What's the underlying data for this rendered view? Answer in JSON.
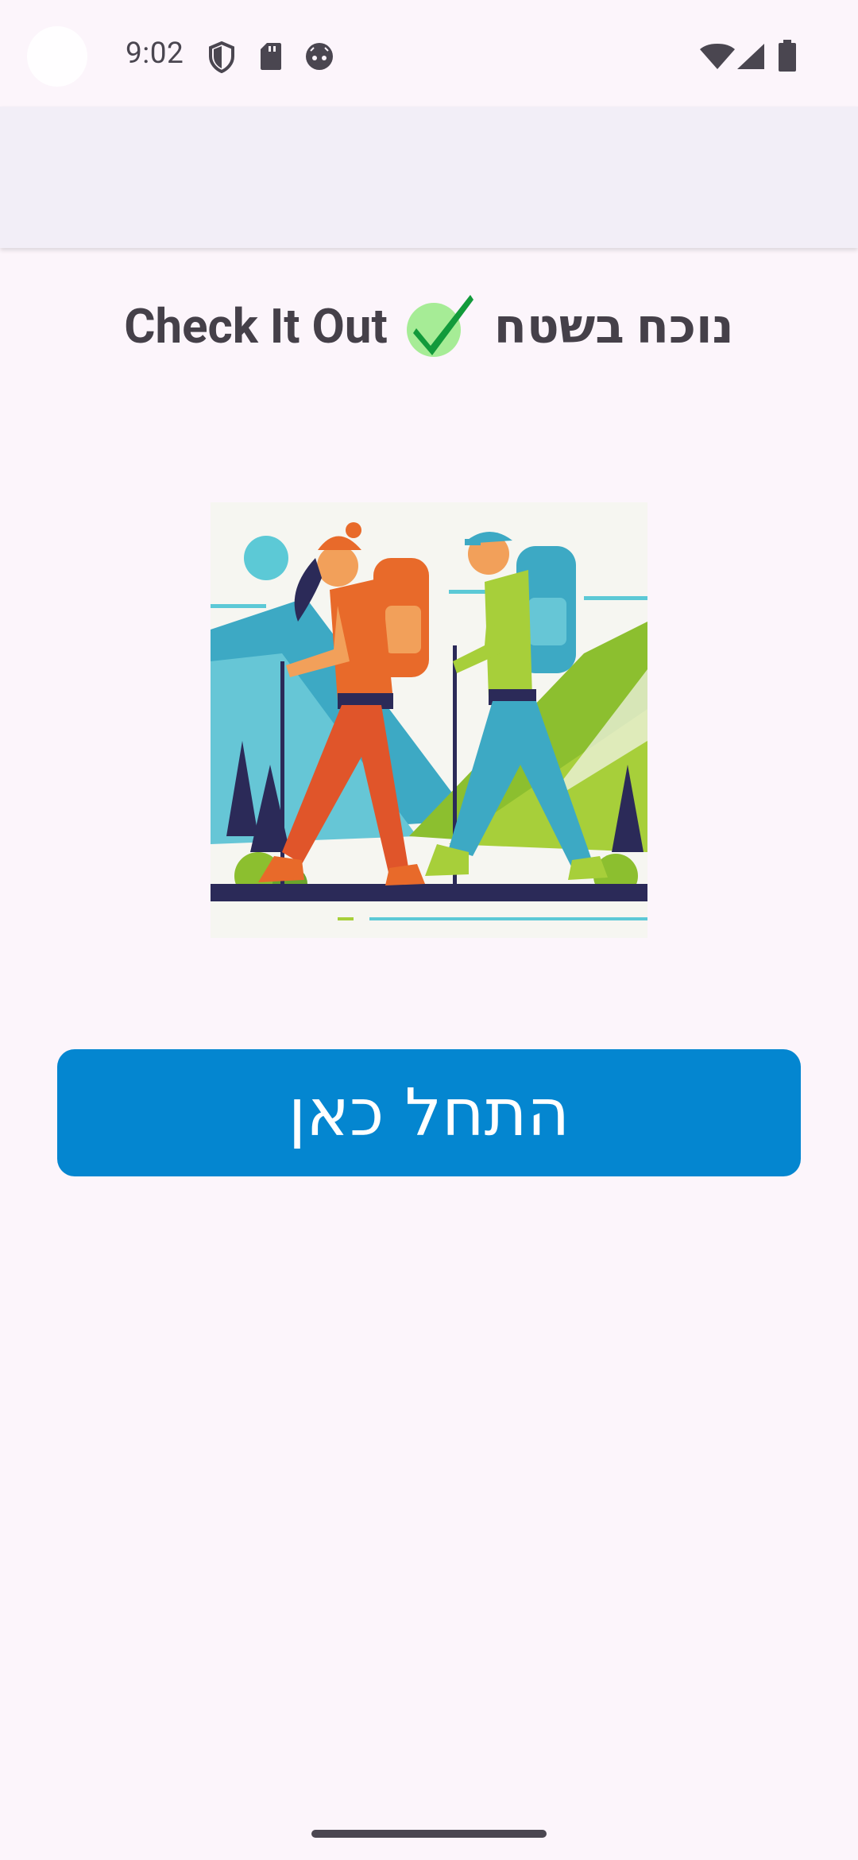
{
  "status_bar": {
    "time": "9:02",
    "icons": [
      "shield-icon",
      "sd-card-icon",
      "android-face-icon",
      "wifi-icon",
      "signal-icon",
      "battery-icon"
    ]
  },
  "app_bar": {
    "title": ""
  },
  "header": {
    "title_en": "Check It Out",
    "check_icon": "green-check-icon",
    "title_he": "נוכח בשטח"
  },
  "illustration": {
    "icon": "hikers-illustration"
  },
  "main": {
    "start_button_label": "התחל כאן"
  },
  "colors": {
    "background": "#fcf5fb",
    "app_bar": "#f2eef7",
    "button": "#0486d0",
    "title_text": "#454049",
    "check_green": "#1a9a3a"
  }
}
